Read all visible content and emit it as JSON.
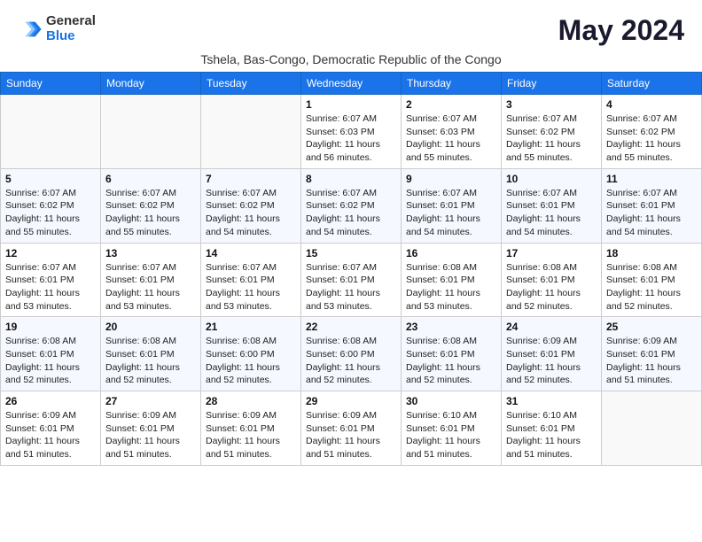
{
  "header": {
    "logo_general": "General",
    "logo_blue": "Blue",
    "month_title": "May 2024",
    "subtitle": "Tshela, Bas-Congo, Democratic Republic of the Congo"
  },
  "days_of_week": [
    "Sunday",
    "Monday",
    "Tuesday",
    "Wednesday",
    "Thursday",
    "Friday",
    "Saturday"
  ],
  "weeks": [
    [
      {
        "day": "",
        "info": ""
      },
      {
        "day": "",
        "info": ""
      },
      {
        "day": "",
        "info": ""
      },
      {
        "day": "1",
        "info": "Sunrise: 6:07 AM\nSunset: 6:03 PM\nDaylight: 11 hours and 56 minutes."
      },
      {
        "day": "2",
        "info": "Sunrise: 6:07 AM\nSunset: 6:03 PM\nDaylight: 11 hours and 55 minutes."
      },
      {
        "day": "3",
        "info": "Sunrise: 6:07 AM\nSunset: 6:02 PM\nDaylight: 11 hours and 55 minutes."
      },
      {
        "day": "4",
        "info": "Sunrise: 6:07 AM\nSunset: 6:02 PM\nDaylight: 11 hours and 55 minutes."
      }
    ],
    [
      {
        "day": "5",
        "info": "Sunrise: 6:07 AM\nSunset: 6:02 PM\nDaylight: 11 hours and 55 minutes."
      },
      {
        "day": "6",
        "info": "Sunrise: 6:07 AM\nSunset: 6:02 PM\nDaylight: 11 hours and 55 minutes."
      },
      {
        "day": "7",
        "info": "Sunrise: 6:07 AM\nSunset: 6:02 PM\nDaylight: 11 hours and 54 minutes."
      },
      {
        "day": "8",
        "info": "Sunrise: 6:07 AM\nSunset: 6:02 PM\nDaylight: 11 hours and 54 minutes."
      },
      {
        "day": "9",
        "info": "Sunrise: 6:07 AM\nSunset: 6:01 PM\nDaylight: 11 hours and 54 minutes."
      },
      {
        "day": "10",
        "info": "Sunrise: 6:07 AM\nSunset: 6:01 PM\nDaylight: 11 hours and 54 minutes."
      },
      {
        "day": "11",
        "info": "Sunrise: 6:07 AM\nSunset: 6:01 PM\nDaylight: 11 hours and 54 minutes."
      }
    ],
    [
      {
        "day": "12",
        "info": "Sunrise: 6:07 AM\nSunset: 6:01 PM\nDaylight: 11 hours and 53 minutes."
      },
      {
        "day": "13",
        "info": "Sunrise: 6:07 AM\nSunset: 6:01 PM\nDaylight: 11 hours and 53 minutes."
      },
      {
        "day": "14",
        "info": "Sunrise: 6:07 AM\nSunset: 6:01 PM\nDaylight: 11 hours and 53 minutes."
      },
      {
        "day": "15",
        "info": "Sunrise: 6:07 AM\nSunset: 6:01 PM\nDaylight: 11 hours and 53 minutes."
      },
      {
        "day": "16",
        "info": "Sunrise: 6:08 AM\nSunset: 6:01 PM\nDaylight: 11 hours and 53 minutes."
      },
      {
        "day": "17",
        "info": "Sunrise: 6:08 AM\nSunset: 6:01 PM\nDaylight: 11 hours and 52 minutes."
      },
      {
        "day": "18",
        "info": "Sunrise: 6:08 AM\nSunset: 6:01 PM\nDaylight: 11 hours and 52 minutes."
      }
    ],
    [
      {
        "day": "19",
        "info": "Sunrise: 6:08 AM\nSunset: 6:01 PM\nDaylight: 11 hours and 52 minutes."
      },
      {
        "day": "20",
        "info": "Sunrise: 6:08 AM\nSunset: 6:01 PM\nDaylight: 11 hours and 52 minutes."
      },
      {
        "day": "21",
        "info": "Sunrise: 6:08 AM\nSunset: 6:00 PM\nDaylight: 11 hours and 52 minutes."
      },
      {
        "day": "22",
        "info": "Sunrise: 6:08 AM\nSunset: 6:00 PM\nDaylight: 11 hours and 52 minutes."
      },
      {
        "day": "23",
        "info": "Sunrise: 6:08 AM\nSunset: 6:01 PM\nDaylight: 11 hours and 52 minutes."
      },
      {
        "day": "24",
        "info": "Sunrise: 6:09 AM\nSunset: 6:01 PM\nDaylight: 11 hours and 52 minutes."
      },
      {
        "day": "25",
        "info": "Sunrise: 6:09 AM\nSunset: 6:01 PM\nDaylight: 11 hours and 51 minutes."
      }
    ],
    [
      {
        "day": "26",
        "info": "Sunrise: 6:09 AM\nSunset: 6:01 PM\nDaylight: 11 hours and 51 minutes."
      },
      {
        "day": "27",
        "info": "Sunrise: 6:09 AM\nSunset: 6:01 PM\nDaylight: 11 hours and 51 minutes."
      },
      {
        "day": "28",
        "info": "Sunrise: 6:09 AM\nSunset: 6:01 PM\nDaylight: 11 hours and 51 minutes."
      },
      {
        "day": "29",
        "info": "Sunrise: 6:09 AM\nSunset: 6:01 PM\nDaylight: 11 hours and 51 minutes."
      },
      {
        "day": "30",
        "info": "Sunrise: 6:10 AM\nSunset: 6:01 PM\nDaylight: 11 hours and 51 minutes."
      },
      {
        "day": "31",
        "info": "Sunrise: 6:10 AM\nSunset: 6:01 PM\nDaylight: 11 hours and 51 minutes."
      },
      {
        "day": "",
        "info": ""
      }
    ]
  ]
}
